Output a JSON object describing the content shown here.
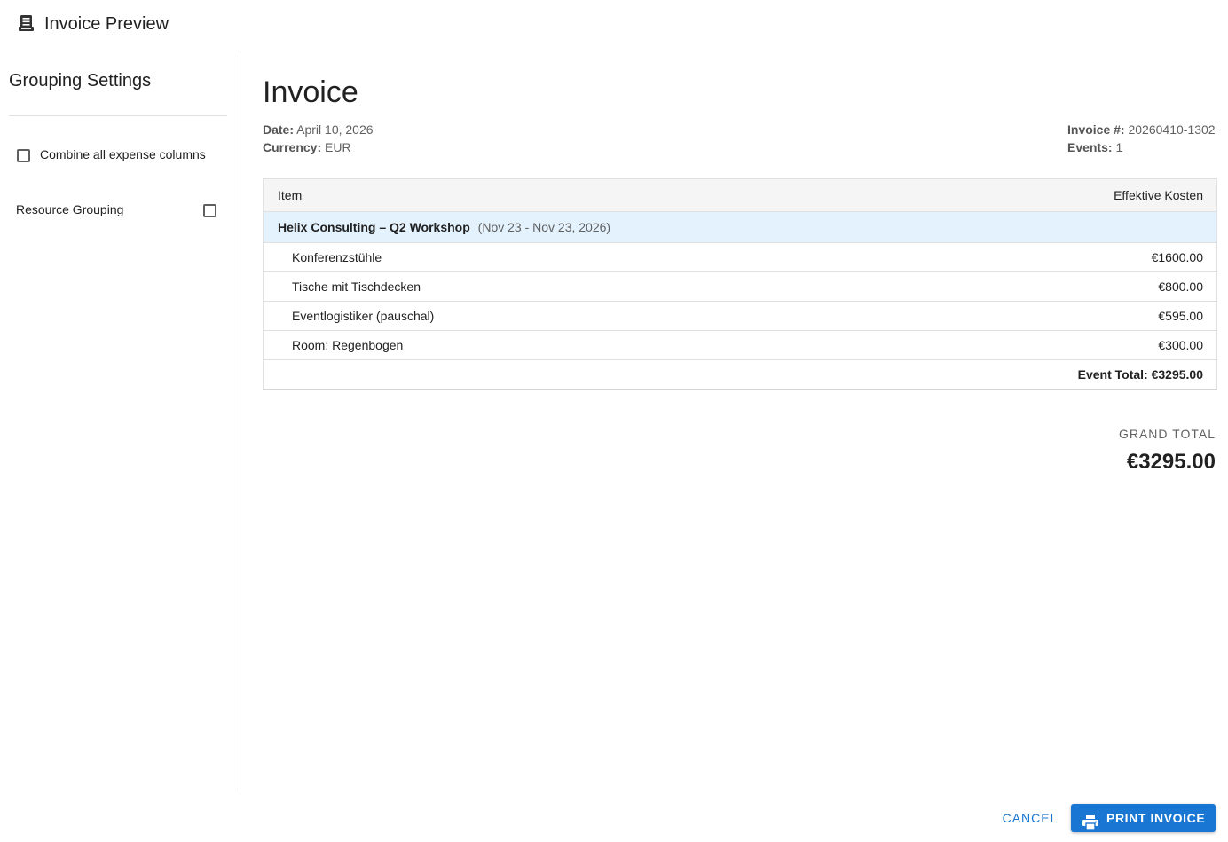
{
  "dialog": {
    "title": "Invoice Preview",
    "title_icon": "receipt-icon"
  },
  "sidebar": {
    "title": "Grouping Settings",
    "options": [
      {
        "label": "Combine all expense columns",
        "checked": false
      },
      {
        "label": "Resource Grouping",
        "checked": false
      }
    ]
  },
  "invoice": {
    "title": "Invoice",
    "date_label": "Date:",
    "date_value": "April 10, 2026",
    "currency_label": "Currency:",
    "currency_value": "EUR",
    "number_label": "Invoice #:",
    "number_value": "20260410-1302",
    "events_label": "Events:",
    "events_value": "1"
  },
  "table": {
    "headers": [
      "Item",
      "Effektive Kosten"
    ],
    "group": {
      "name": "Helix Consulting – Q2 Workshop",
      "dates": "(Nov 23 - Nov 23, 2026)"
    },
    "rows": [
      {
        "item": "Konferenzstühle",
        "cost": "€1600.00"
      },
      {
        "item": "Tische mit Tischdecken",
        "cost": "€800.00"
      },
      {
        "item": "Eventlogistiker (pauschal)",
        "cost": "€595.00"
      },
      {
        "item": "Room: Regenbogen",
        "cost": "€300.00"
      }
    ],
    "event_total": "Event Total: €3295.00"
  },
  "grand_total": {
    "label": "GRAND TOTAL",
    "value": "€3295.00"
  },
  "actions": {
    "cancel_label": "CANCEL",
    "print_label": "PRINT INVOICE",
    "print_icon": "printer-icon"
  },
  "colors": {
    "accent": "#1976d2",
    "group_row_bg": "#e3f2fd",
    "header_row_bg": "#f5f5f5"
  }
}
